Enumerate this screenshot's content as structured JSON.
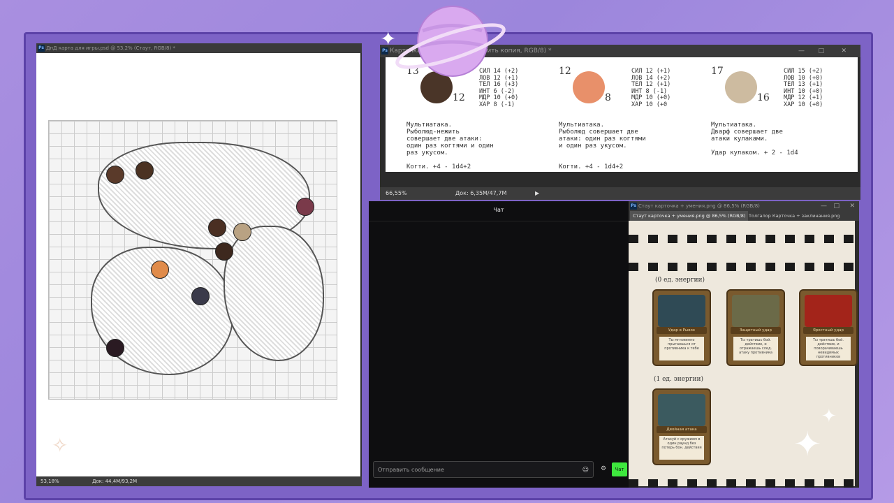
{
  "map_window": {
    "title": "ДнД карта для игры.psd @ 53,2% (Стаут, RGB/8) *",
    "status_zoom": "53,18%",
    "status_doc": "Док: 44,4M/93,2M"
  },
  "sheet_window": {
    "title": "Карточка ... % (Рыболюд нежить копия, RGB/8) *",
    "status_zoom": "66,55%",
    "status_doc": "Док: 6,35M/47,7M",
    "monsters": [
      {
        "ac": "13",
        "hp": "12",
        "stats": [
          "СИЛ 14 (+2)",
          "ЛОВ 12 (+1)",
          "ТЕЛ 16 (+3)",
          "ИНТ 6 (-2)",
          "МДР 10 (+0)",
          "ХАР 8 (-1)"
        ],
        "feature": "Мультиатака.\nРыболюд-нежить\nсовершает две атаки:\nодин раз когтями и один\nраз укусом.",
        "attack": "Когти. +4 - 1d4+2"
      },
      {
        "ac": "12",
        "hp": "8",
        "stats": [
          "СИЛ 12 (+1)",
          "ЛОВ 14 (+2)",
          "ТЕЛ 12 (+1)",
          "ИНТ 8 (-1)",
          "МДР 10 (+0)",
          "ХАР 10 (+0"
        ],
        "feature": "Мультиатака.\nРыболюд совершает две\nатаки: один раз когтями\nи один раз укусом.",
        "attack": "Когти. +4 - 1d4+2"
      },
      {
        "ac": "17",
        "hp": "16",
        "stats": [
          "СИЛ 15 (+2)",
          "ЛОВ 10 (+0)",
          "ТЕЛ 13 (+1)",
          "ИНТ 10 (+0)",
          "МДР 12 (+1)",
          "ХАР 10 (+0)"
        ],
        "feature": "Мультиатака.\nДварф совершает две\nатаки кулаками.\n\nУдар кулаком. + 2 - 1d4",
        "attack": ""
      }
    ]
  },
  "chat": {
    "title": "Чат",
    "input_placeholder": "Отправить сообщение",
    "send_label": "Чат"
  },
  "cards_window": {
    "title": "Стаут карточка + умения.png @ 86,5% (RGB/8)",
    "tabs": [
      "Стаут карточка + умения.png @ 86,5% (RGB/8)",
      "Толгалор Карточка + заклинания.png"
    ],
    "energy_0": "(0 ед. энергии)",
    "energy_1": "(1 ед. энергии)",
    "cards": [
      {
        "name": "Удар в Рывок",
        "text": "Ты мгновенно прыгаешься от противника к тебе",
        "art_color": "#2f4a55"
      },
      {
        "name": "Защитный удар",
        "text": "Ты тратишь бой. действие, и отражаешь след. атаку противника",
        "art_color": "#6b6a48"
      },
      {
        "name": "Яростный удар",
        "text": "Ты тратишь бой. действие, и поворачиваешь невидимых противников",
        "art_color": "#a3241a"
      },
      {
        "name": "Двойная атака",
        "text": "Атакуй с оружием в один раунд без потерь бон. действия",
        "art_color": "#3b5a5f"
      }
    ]
  },
  "colors": {
    "background": "#a98fe0",
    "frame": "#7d63c6",
    "chat_send": "#3ee83e"
  }
}
